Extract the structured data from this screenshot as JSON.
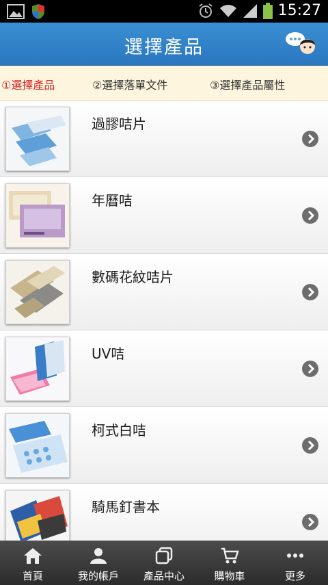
{
  "status_bar": {
    "time": "15:27"
  },
  "header": {
    "title": "選擇產品"
  },
  "steps": [
    {
      "label": "①選擇產品",
      "active": true
    },
    {
      "label": "②選擇落單文件",
      "active": false
    },
    {
      "label": "③選擇產品屬性",
      "active": false
    }
  ],
  "products": [
    {
      "name": "過膠咭片"
    },
    {
      "name": "年曆咭"
    },
    {
      "name": "數碼花紋咭片"
    },
    {
      "name": "UV咭"
    },
    {
      "name": "柯式白咭"
    },
    {
      "name": "騎馬釘書本"
    }
  ],
  "bottom_nav": [
    {
      "label": "首頁",
      "icon": "home-icon"
    },
    {
      "label": "我的帳戶",
      "icon": "account-icon"
    },
    {
      "label": "產品中心",
      "icon": "products-icon"
    },
    {
      "label": "購物車",
      "icon": "cart-icon"
    },
    {
      "label": "更多",
      "icon": "more-icon"
    }
  ],
  "colors": {
    "header": "#2a77bf",
    "steps_bg": "#fdf5dd",
    "active_step": "#d9262a",
    "nav_bg": "#2c2c2c"
  }
}
